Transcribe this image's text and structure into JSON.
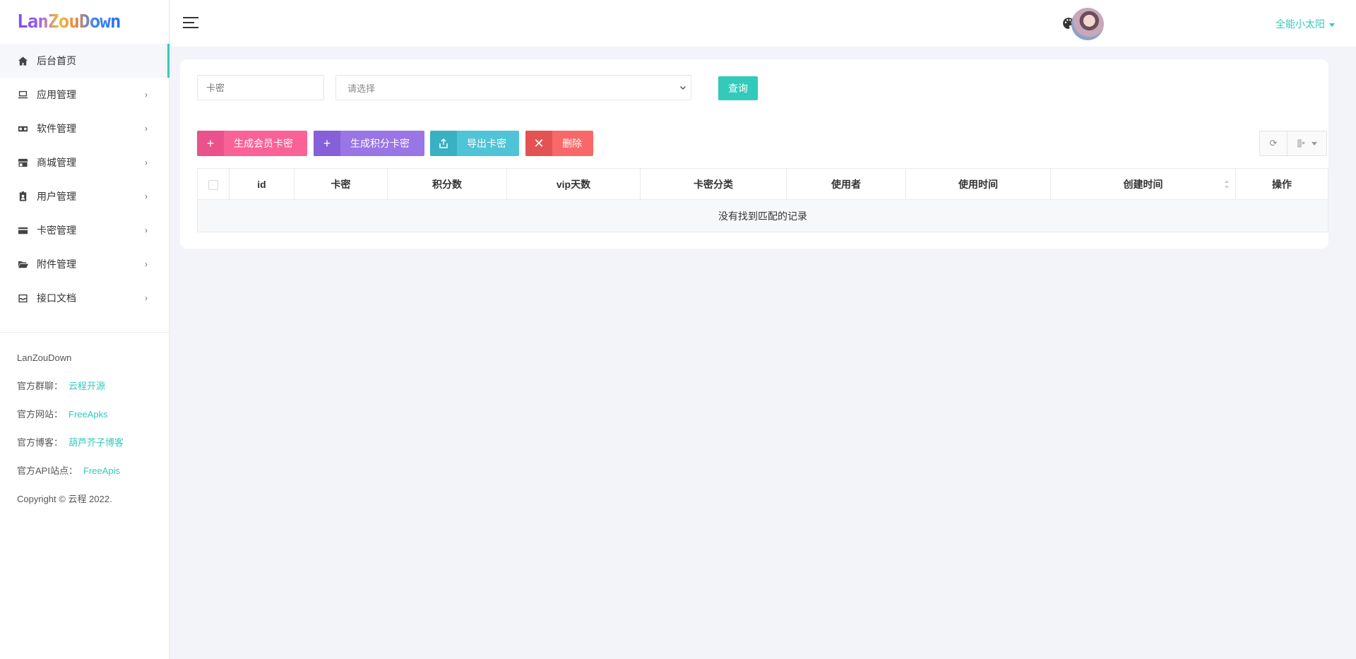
{
  "logo": {
    "text": "LanZouDown"
  },
  "sidebar": {
    "items": [
      {
        "label": "后台首页",
        "icon": "home-icon",
        "active": true
      },
      {
        "label": "应用管理",
        "icon": "desktop-icon",
        "arrow": "›"
      },
      {
        "label": "软件管理",
        "icon": "software-icon",
        "arrow": "›"
      },
      {
        "label": "商城管理",
        "icon": "store-icon",
        "arrow": "›"
      },
      {
        "label": "用户管理",
        "icon": "user-badge-icon",
        "arrow": "›"
      },
      {
        "label": "卡密管理",
        "icon": "credit-card-icon",
        "arrow": "›"
      },
      {
        "label": "附件管理",
        "icon": "folder-open-icon",
        "arrow": "›"
      },
      {
        "label": "接口文档",
        "icon": "archive-icon",
        "arrow": "›"
      }
    ],
    "info": {
      "brand": "LanZouDown",
      "group_label": "官方群聊：",
      "group_link": "云程开源",
      "site_label": "官方网站：",
      "site_link": "FreeApks",
      "blog_label": "官方博客：",
      "blog_link": "葫芦芥子博客",
      "api_label": "官方API站点：",
      "api_link": "FreeApis",
      "copyright": "Copyright © 云程 2022."
    }
  },
  "header": {
    "username": "全能小太阳"
  },
  "search": {
    "card_placeholder": "卡密",
    "select_placeholder": "请选择",
    "query_label": "查询"
  },
  "toolbar": {
    "gen_member_label": "生成会员卡密",
    "gen_points_label": "生成积分卡密",
    "export_label": "导出卡密",
    "delete_label": "删除"
  },
  "table": {
    "columns": [
      "id",
      "卡密",
      "积分数",
      "vip天数",
      "卡密分类",
      "使用者",
      "使用时间",
      "创建时间",
      "操作"
    ],
    "empty_text": "没有找到匹配的记录"
  },
  "colors": {
    "accent": "#33cabb",
    "pink": "#f96197",
    "purple": "#9a75e6",
    "cyan": "#4fc4d6",
    "red": "#f96868"
  }
}
